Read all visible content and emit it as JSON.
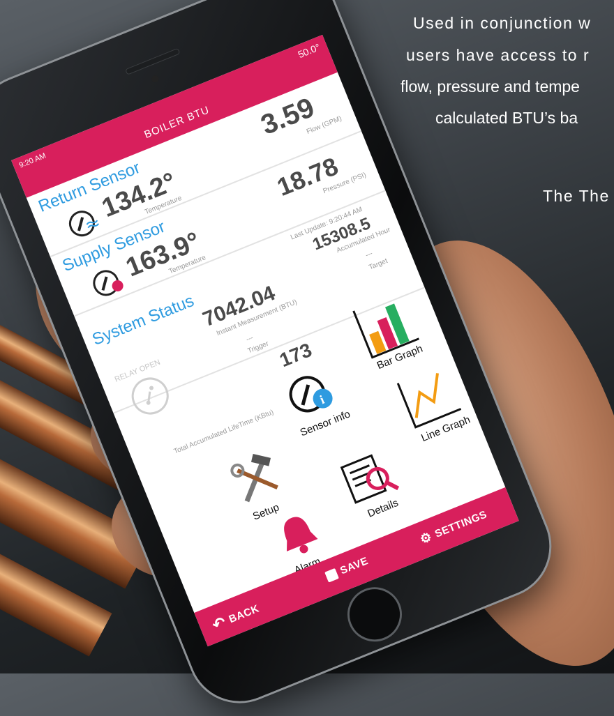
{
  "background": {
    "copy_lines": [
      "Used in conjunction w",
      "users have access to r",
      "flow, pressure and tempe",
      "calculated BTU’s ba",
      "The The"
    ]
  },
  "status_bar": {
    "time": "9:20 AM",
    "temperature": "50.0°"
  },
  "app": {
    "title": "BOILER BTU"
  },
  "return_sensor": {
    "title": "Return Sensor",
    "temperature": "134.2°",
    "temperature_label": "Temperature",
    "flow": "3.59",
    "flow_label": "Flow (GPM)"
  },
  "supply_sensor": {
    "title": "Supply Sensor",
    "temperature": "163.9°",
    "temperature_label": "Temperature",
    "pressure": "18.78",
    "pressure_label": "Pressure (PSI)"
  },
  "system_status": {
    "title": "System Status",
    "last_update": "Last Update: 9:20:44 AM",
    "instant": "7042.04",
    "instant_label": "Instant Measurement (BTU)",
    "accumulated_hour": "15308.5",
    "accumulated_hour_label": "Accumulated Hour",
    "relay": "RELAY OPEN",
    "trigger_value": "---",
    "trigger_label": "Trigger",
    "target_value": "---",
    "target_label": "Target",
    "lifetime": "173",
    "lifetime_label": "Total Accumulated LifeTime (KBtu)"
  },
  "menu": {
    "bar_graph": "Bar Graph",
    "sensor_info": "Sensor info",
    "line_graph": "Line Graph",
    "setup": "Setup",
    "details": "Details",
    "alarm": "Alarm"
  },
  "bottom_nav": {
    "back": "BACK",
    "save": "SAVE",
    "settings": "SETTINGS"
  },
  "colors": {
    "accent": "#d81f5c",
    "title_blue": "#2e9be0",
    "value_gray": "#4a4a4a"
  },
  "icons": {
    "thermo": "thermometer-waves-icon",
    "supply": "thermometer-flame-icon",
    "relay": "relay-switch-icon",
    "bar": "bar-graph-icon",
    "info": "sensor-info-icon",
    "line": "line-graph-icon",
    "setup": "tools-icon",
    "details": "details-magnifier-icon",
    "alarm": "alarm-bell-icon"
  }
}
